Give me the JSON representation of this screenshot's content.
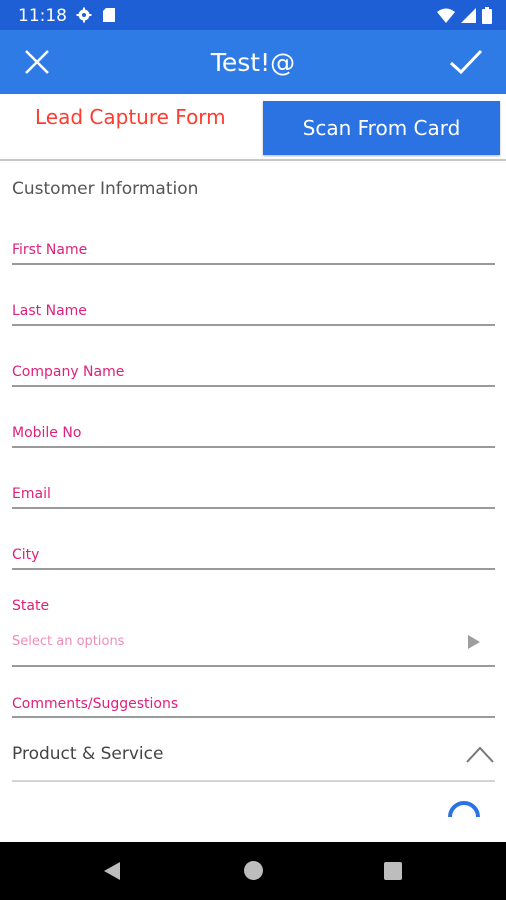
{
  "status_bar": {
    "time": "11:18"
  },
  "app_bar": {
    "title": "Test!@"
  },
  "header": {
    "form_title": "Lead Capture Form",
    "scan_button_label": "Scan From Card"
  },
  "section": {
    "title": "Customer Information"
  },
  "fields": [
    {
      "label": "First Name"
    },
    {
      "label": "Last Name"
    },
    {
      "label": "Company Name"
    },
    {
      "label": "Mobile No"
    },
    {
      "label": "Email"
    },
    {
      "label": "City"
    }
  ],
  "state": {
    "label": "State",
    "placeholder": "Select an options"
  },
  "comments": {
    "label": "Comments/Suggestions"
  },
  "product": {
    "label": "Product & Service"
  },
  "colors": {
    "status_bar": "#1e5fd6",
    "app_bar": "#2f7be6",
    "accent_button": "#2b73e2",
    "form_title": "#ff3b2f",
    "field_label": "#e0207a",
    "placeholder": "#f08cb8"
  }
}
